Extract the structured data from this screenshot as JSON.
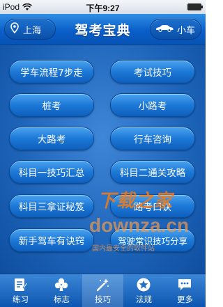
{
  "status_bar": {
    "carrier": "iPod",
    "time": "下午9:27"
  },
  "header": {
    "location": "上海",
    "title": "驾考宝典",
    "vehicle": "小车"
  },
  "menu": {
    "items": [
      {
        "label": "学车流程7步走"
      },
      {
        "label": "考试技巧"
      },
      {
        "label": "桩考"
      },
      {
        "label": "小路考"
      },
      {
        "label": "大路考"
      },
      {
        "label": "行车咨询"
      },
      {
        "label": "科目一技巧汇总"
      },
      {
        "label": "科目二通关攻略"
      },
      {
        "label": "科目三拿证秘笈"
      },
      {
        "label": "路考口诀"
      },
      {
        "label": "新手驾车有诀窍"
      },
      {
        "label": "驾驶常识技巧分享"
      }
    ]
  },
  "tabs": [
    {
      "label": "练习",
      "icon": "practice-icon",
      "active": false
    },
    {
      "label": "标志",
      "icon": "club-icon",
      "active": false
    },
    {
      "label": "技巧",
      "icon": "magic-wand-icon",
      "active": true
    },
    {
      "label": "法规",
      "icon": "star-icon",
      "active": false
    },
    {
      "label": "更多",
      "icon": "chat-bubble-icon",
      "active": false
    }
  ],
  "watermark": {
    "line1": "下载之家",
    "line2": "downza.cn",
    "line3": "国内最安全的软件站"
  },
  "colors": {
    "header": "#0a5ec9",
    "button": "#1d78d6",
    "background": "#1c63b8",
    "watermark": "#f07c1a"
  }
}
